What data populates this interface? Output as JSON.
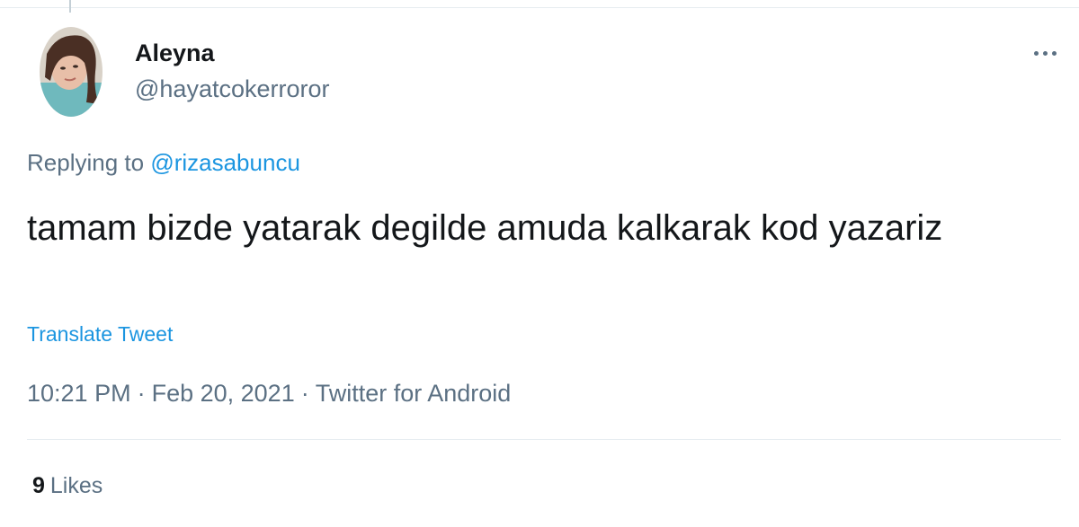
{
  "tweet": {
    "author": {
      "display_name": "Aleyna",
      "handle": "@hayatcokerroror"
    },
    "replying_to": {
      "prefix": "Replying to",
      "mention": "@rizasabuncu"
    },
    "text": "tamam bizde yatarak degilde amuda kalkarak kod yazariz",
    "translate_label": "Translate Tweet",
    "time": "10:21 PM",
    "date": "Feb 20, 2021",
    "separator": "·",
    "source": "Twitter for Android",
    "likes": {
      "count": "9",
      "label": "Likes"
    }
  },
  "icons": {
    "more": "more-options-icon",
    "avatar": "profile-photo"
  },
  "colors": {
    "text_primary": "#14171a",
    "text_secondary": "#5b7083",
    "link": "#1b95e0",
    "divider": "#e6ecf0"
  }
}
